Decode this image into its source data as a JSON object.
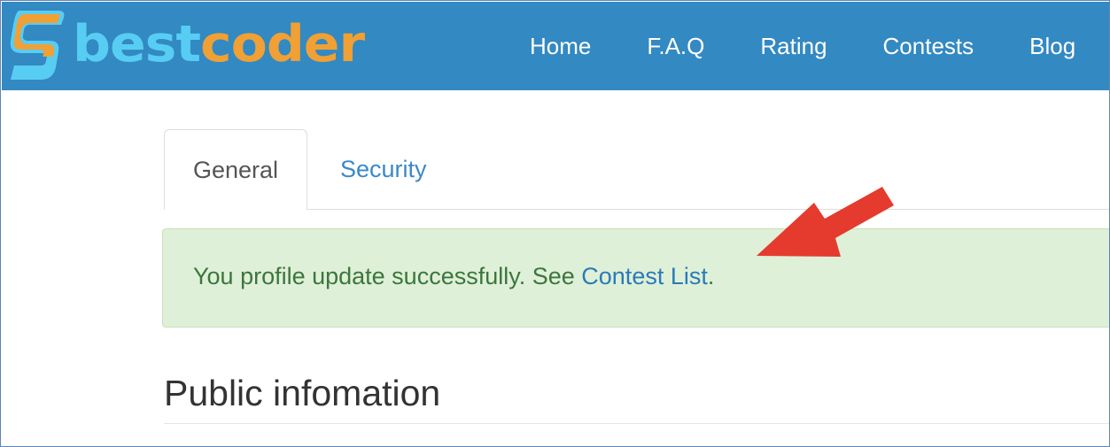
{
  "header": {
    "logo": {
      "text_best": "best",
      "text_coder": "coder",
      "colors": {
        "best": "#58cdf3",
        "coder": "#f0a034"
      }
    },
    "nav": [
      "Home",
      "F.A.Q",
      "Rating",
      "Contests",
      "Blog"
    ],
    "background_color": "#3389c2"
  },
  "tabs": {
    "general": "General",
    "security": "Security",
    "active": "General"
  },
  "alert": {
    "message": "You profile update successfully. See ",
    "link_text": "Contest List",
    "suffix": ".",
    "background_color": "#dff0d8"
  },
  "annotation": {
    "icon": "red-arrow-icon",
    "color": "#e53a2e"
  },
  "section": {
    "title": "Public infomation"
  }
}
